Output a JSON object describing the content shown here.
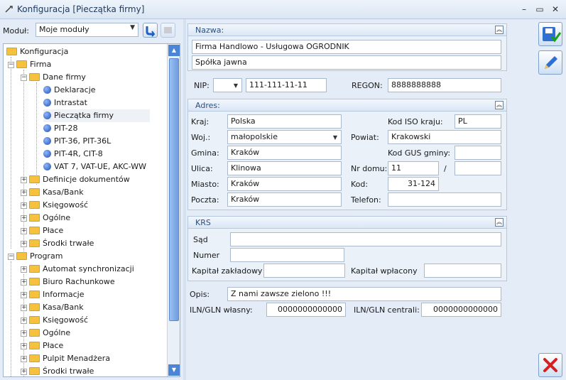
{
  "window": {
    "title": "Konfiguracja [Pieczątka firmy]",
    "controls": [
      "–",
      "▭",
      "✕"
    ]
  },
  "left": {
    "modul_label": "Moduł:",
    "modul_value": "Moje moduły",
    "tree": {
      "root": "Konfiguracja",
      "firma": "Firma",
      "dane_firmy": "Dane firmy",
      "dane_children": [
        "Deklaracje",
        "Intrastat",
        "Pieczątka firmy",
        "PIT-28",
        "PIT-36, PIT-36L",
        "PIT-4R, CIT-8",
        "VAT 7, VAT-UE, AKC-WW"
      ],
      "firma_children": [
        "Definicje dokumentów",
        "Kasa/Bank",
        "Księgowość",
        "Ogólne",
        "Płace",
        "Środki trwałe"
      ],
      "program": "Program",
      "program_children": [
        "Automat synchronizacji",
        "Biuro Rachunkowe",
        "Informacje",
        "Kasa/Bank",
        "Księgowość",
        "Ogólne",
        "Płace",
        "Pulpit Menadżera",
        "Środki trwałe"
      ]
    }
  },
  "nazwa": {
    "header": "Nazwa:",
    "line1": "Firma Handlowo - Usługowa OGRODNIK",
    "line2": "Spółka jawna"
  },
  "ids": {
    "nip_label": "NIP:",
    "nip_prefix": "",
    "nip_value": "111-111-11-11",
    "regon_label": "REGON:",
    "regon_value": "8888888888"
  },
  "adres": {
    "header": "Adres:",
    "kraj_label": "Kraj:",
    "kraj_value": "Polska",
    "iso_label": "Kod ISO kraju:",
    "iso_value": "PL",
    "woj_label": "Woj.:",
    "woj_value": "małopolskie",
    "powiat_label": "Powiat:",
    "powiat_value": "Krakowski",
    "gmina_label": "Gmina:",
    "gmina_value": "Kraków",
    "gus_label": "Kod GUS gminy:",
    "gus_value": "",
    "ulica_label": "Ulica:",
    "ulica_value": "Klinowa",
    "nrdomu_label": "Nr domu:",
    "nrdomu_value": "11",
    "slash": "/",
    "nrlokalu_value": "",
    "miasto_label": "Miasto:",
    "miasto_value": "Kraków",
    "kod_label": "Kod:",
    "kod_value": "31-124",
    "poczta_label": "Poczta:",
    "poczta_value": "Kraków",
    "telefon_label": "Telefon:",
    "telefon_value": ""
  },
  "krs": {
    "header": "KRS",
    "sad_label": "Sąd",
    "sad_value": "",
    "numer_label": "Numer",
    "numer_value": "",
    "kz_label": "Kapitał zakładowy",
    "kz_value": "",
    "kw_label": "Kapitał wpłacony",
    "kw_value": ""
  },
  "other": {
    "opis_label": "Opis:",
    "opis_value": "Z nami zawsze zielono !!!",
    "iln_label": "ILN/GLN własny:",
    "iln_value": "0000000000000",
    "ilnc_label": "ILN/GLN centrali:",
    "ilnc_value": "0000000000000"
  },
  "colors": {
    "accent": "#2a4f83",
    "folder": "#f6c23e",
    "cancel": "#d42020"
  }
}
